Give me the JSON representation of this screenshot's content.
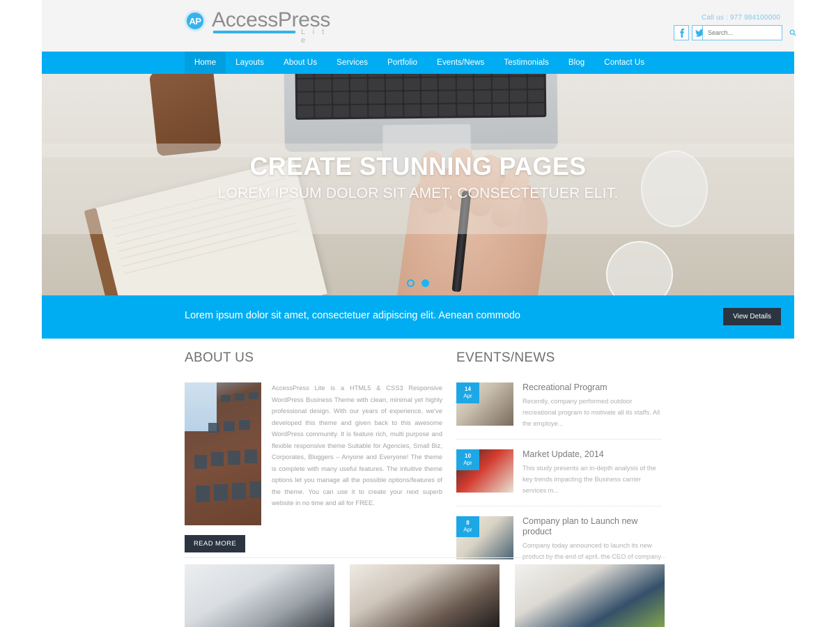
{
  "header": {
    "logo": {
      "badge": "AP",
      "name": "AccessPress",
      "sub": "L i t e"
    },
    "call_us": "Call us : 977 984100000",
    "social": [
      {
        "name": "facebook-icon",
        "label": "f"
      },
      {
        "name": "twitter-icon",
        "label": "t"
      }
    ],
    "search": {
      "placeholder": "Search...",
      "value": "",
      "icon": "search-icon"
    }
  },
  "nav": {
    "items": [
      {
        "label": "Home",
        "active": true
      },
      {
        "label": "Layouts",
        "active": false
      },
      {
        "label": "About Us",
        "active": false
      },
      {
        "label": "Services",
        "active": false
      },
      {
        "label": "Portfolio",
        "active": false
      },
      {
        "label": "Events/News",
        "active": false
      },
      {
        "label": "Testimonials",
        "active": false
      },
      {
        "label": "Blog",
        "active": false
      },
      {
        "label": "Contact Us",
        "active": false
      }
    ]
  },
  "hero": {
    "title": "CREATE STUNNING PAGES",
    "subtitle": "LOREM IPSUM DOLOR SIT AMET, CONSECTETUER ELIT.",
    "dots": [
      {
        "active": false
      },
      {
        "active": true
      }
    ]
  },
  "cta": {
    "text": "Lorem ipsum dolor sit amet, consectetuer adipiscing elit. Aenean commodo",
    "button": "View Details"
  },
  "about": {
    "title": "ABOUT US",
    "image_alt": "brick-building-photo",
    "body": "AccessPress Lite is a HTML5 & CSS3 Responsive WordPress Business Theme with clean, minimal yet highly professional design. With our years of experience, we've developed this theme and given back to this awesome WordPress community. It is feature rich, multi purpose and flexible responsive theme Suitable for Agencies, Small Biz, Corporates, Bloggers – Anyone and Everyone! The theme is complete with many useful features. The intuitive theme options let you manage all the possible options/features of the theme. You can use it to create your next superb website in no time and all for FREE.",
    "read_more": "READ MORE"
  },
  "events": {
    "title": "EVENTS/NEWS",
    "items": [
      {
        "day": "14",
        "month": "Apr",
        "title": "Recreational Program",
        "desc": "Recently, company performed outdoor recreational program to motivate all its staffs. All the employe..."
      },
      {
        "day": "10",
        "month": "Apr",
        "title": "Market Update, 2014",
        "desc": "This study presents an in-depth analysis of the key trends impacting the Business carrier services m..."
      },
      {
        "day": "8",
        "month": "Apr",
        "title": "Company plan to Launch new product",
        "desc": "Company today announced to launch its new product by the end of april. the CEO of company announced ..."
      }
    ]
  },
  "portfolio": {
    "items": [
      {
        "alt": "desk-laptop-watch-photo"
      },
      {
        "alt": "headphones-desk-photo"
      },
      {
        "alt": "tablet-headphones-plant-photo"
      }
    ]
  },
  "colors": {
    "brand_blue": "#00adf2",
    "logo_blue": "#35b3ec",
    "dark_button": "#2b3441",
    "body_text": "#a3a3a3"
  }
}
